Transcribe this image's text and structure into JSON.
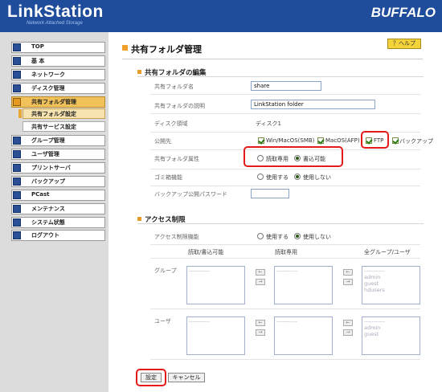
{
  "header": {
    "logo": "LinkStation",
    "logo_sub": "Network Attached Storage",
    "brand": "BUFFALO"
  },
  "sidebar": {
    "items": [
      {
        "label": "TOP",
        "icon": "monitor-icon"
      },
      {
        "label": "基 本",
        "icon": "settings-icon"
      },
      {
        "label": "ネットワーク",
        "icon": "network-icon"
      },
      {
        "label": "ディスク管理",
        "icon": "disk-icon"
      },
      {
        "label": "共有フォルダ管理",
        "icon": "folder-icon"
      },
      {
        "label": "グループ管理",
        "icon": "group-icon"
      },
      {
        "label": "ユーザ管理",
        "icon": "user-icon"
      },
      {
        "label": "プリントサーバ",
        "icon": "printer-icon"
      },
      {
        "label": "バックアップ",
        "icon": "backup-icon"
      },
      {
        "label": "PCast",
        "icon": "pcast-icon"
      },
      {
        "label": "メンテナンス",
        "icon": "maintenance-icon"
      },
      {
        "label": "システム状態",
        "icon": "status-icon"
      },
      {
        "label": "ログアウト",
        "icon": "logout-icon"
      }
    ],
    "subitems": [
      {
        "label": "共有フォルダ設定"
      },
      {
        "label": "共有サービス設定"
      }
    ]
  },
  "main": {
    "title": "共有フォルダ管理",
    "help": "？ヘルプ",
    "edit_section": {
      "title": "共有フォルダの編集",
      "rows": {
        "name_label": "共有フォルダ名",
        "name_value": "share",
        "desc_label": "共有フォルダの説明",
        "desc_value": "LinkStation folder",
        "disk_label": "ディスク領域",
        "disk_value": "ディスク1",
        "public_label": "公開先",
        "public_opts": [
          "Win/MacOS(SMB)",
          "MacOS(AFP)",
          "FTP",
          "バックアップ"
        ],
        "attr_label": "共有フォルダ属性",
        "attr_opts": [
          "読取専用",
          "書込可能"
        ],
        "trash_label": "ゴミ箱機能",
        "trash_opts": [
          "使用する",
          "使用しない"
        ],
        "backup_pw_label": "バックアップ公開パスワード",
        "backup_pw_value": ""
      }
    },
    "access_section": {
      "title": "アクセス制限",
      "limit_label": "アクセス制限機能",
      "limit_opts": [
        "使用する",
        "使用しない"
      ],
      "col_rw": "読取/書込可能",
      "col_ro": "読取専用",
      "col_all": "全グループ/ユーザ",
      "group_label": "グループ",
      "user_label": "ユーザ",
      "placeholder": "-----------",
      "groups_all": [
        "admin",
        "guest",
        "hdusers"
      ],
      "users_all": [
        "admin",
        "guest"
      ],
      "arrow_left": "←",
      "arrow_right": "→"
    },
    "buttons": {
      "save": "設定",
      "cancel": "キャンセル"
    }
  },
  "colors": {
    "header": "#1f4d9b",
    "active_nav": "#f1c15a",
    "highlight": "#e41b1b"
  }
}
